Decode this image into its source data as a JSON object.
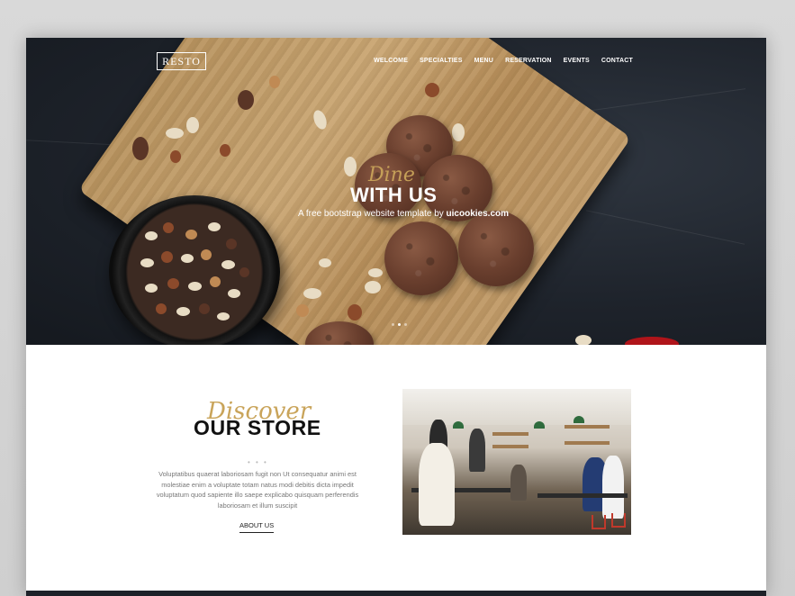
{
  "brand": {
    "logo_text": "RESTO"
  },
  "nav": {
    "items": [
      {
        "label": "WELCOME"
      },
      {
        "label": "SPECIALTIES"
      },
      {
        "label": "MENU"
      },
      {
        "label": "RESERVATION"
      },
      {
        "label": "EVENTS"
      },
      {
        "label": "CONTACT"
      }
    ]
  },
  "hero": {
    "script_text": "Dine",
    "title": "WITH US",
    "subtitle_prefix": "A free bootstrap website template by ",
    "subtitle_brand": "uicookies.com",
    "slides": 3,
    "active_slide": 1
  },
  "store": {
    "script_text": "Discover",
    "title": "OUR STORE",
    "divider": "• • •",
    "text": "Voluptatibus quaerat laboriosam fugit non Ut consequatur animi est molestiae enim a voluptate totam natus modi debitis dicta impedit voluptatum quod sapiente illo saepe explicabo quisquam perferendis laboriosam et illum suscipit",
    "link_label": "ABOUT US"
  },
  "colors": {
    "accent_gold": "#c9a45a",
    "hero_bg": "#1e232b",
    "text_dark": "#111111",
    "text_muted": "#777777"
  }
}
